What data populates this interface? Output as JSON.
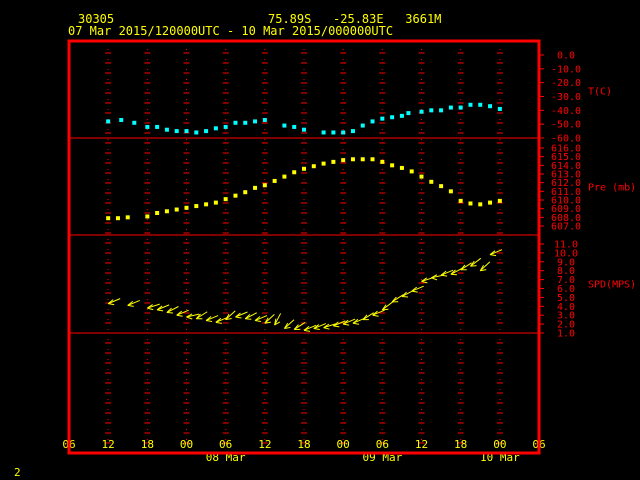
{
  "header": {
    "station_id": "30305",
    "location": "75.89S   -25.83E   3661M",
    "time_range": "07 Mar 2015/120000UTC - 10 Mar 2015/000000UTC"
  },
  "page_number": "2",
  "colors": {
    "frame": "#ff0000",
    "temperature": "#00ffff",
    "pressure": "#ffff00",
    "wind": "#ffff00",
    "text": "#ffff00"
  },
  "chart_data": {
    "type": "scatter",
    "x_axis": {
      "tick_labels": [
        "06",
        "12",
        "18",
        "00",
        "06",
        "12",
        "18",
        "00",
        "06",
        "12",
        "18",
        "00",
        "06"
      ],
      "day_labels": [
        "08 Mar",
        "09 Mar",
        "10 Mar"
      ],
      "xlim_hours": [
        -6,
        66
      ]
    },
    "panels": [
      {
        "name": "T(C)",
        "ylim": [
          -60,
          0
        ],
        "y_ticks": [
          "0.0",
          "-10.0",
          "-20.0",
          "-30.0",
          "-40.0",
          "-50.0",
          "-60.0"
        ],
        "x_hours": [
          0,
          2,
          4,
          6,
          7.5,
          9,
          10.5,
          12,
          13.5,
          15,
          16.5,
          18,
          19.5,
          21,
          22.5,
          24,
          27,
          28.5,
          30,
          33,
          34.5,
          36,
          37.5,
          39,
          40.5,
          42,
          43.5,
          45,
          46,
          48,
          49.5,
          51,
          52.5,
          54,
          55.5,
          57,
          58.5,
          60
        ],
        "values": [
          -48,
          -47,
          -49,
          -52,
          -52,
          -54,
          -55,
          -55,
          -56,
          -55,
          -53,
          -52,
          -49,
          -49,
          -48,
          -47,
          -51,
          -52,
          -54,
          -56,
          -56,
          -56,
          -55,
          -51,
          -48,
          -46,
          -45,
          -44,
          -42,
          -41,
          -40,
          -40,
          -38,
          -38,
          -36,
          -36,
          -37,
          -39
        ]
      },
      {
        "name": "Pre (mb)",
        "ylim": [
          607,
          616
        ],
        "y_ticks": [
          "616.0",
          "615.0",
          "614.0",
          "613.0",
          "612.0",
          "611.0",
          "610.0",
          "609.0",
          "608.0",
          "607.0"
        ],
        "x_hours": [
          0,
          1.5,
          3,
          6,
          7.5,
          9,
          10.5,
          12,
          13.5,
          15,
          16.5,
          18,
          19.5,
          21,
          22.5,
          24,
          25.5,
          27,
          28.5,
          30,
          31.5,
          33,
          34.5,
          36,
          37.5,
          39,
          40.5,
          42,
          43.5,
          45,
          46.5,
          48,
          49.5,
          51,
          52.5,
          54,
          55.5,
          57,
          58.5,
          60
        ],
        "values": [
          607.9,
          607.9,
          608,
          608.1,
          608.5,
          608.7,
          608.9,
          609.1,
          609.3,
          609.5,
          609.7,
          610.1,
          610.5,
          610.9,
          611.4,
          611.7,
          612.2,
          612.7,
          613.2,
          613.6,
          613.9,
          614.2,
          614.4,
          614.6,
          614.7,
          614.7,
          614.7,
          614.4,
          614.0,
          613.7,
          613.3,
          612.7,
          612.1,
          611.6,
          611.0,
          609.9,
          609.6,
          609.5,
          609.7,
          609.9
        ]
      },
      {
        "name": "SPD(MPS)",
        "ylim": [
          1,
          11
        ],
        "y_ticks": [
          "11.0",
          "10.0",
          "9.0",
          "8.0",
          "7.0",
          "6.0",
          "5.0",
          "4.0",
          "3.0",
          "2.0",
          "1.0"
        ],
        "x_hours": [
          0,
          3,
          6,
          7.5,
          9,
          10.5,
          12,
          13.5,
          15,
          16.5,
          18,
          19.5,
          21,
          22.5,
          24,
          25.5,
          27,
          28.5,
          30,
          31.5,
          33,
          34.5,
          36,
          37.5,
          39,
          40.5,
          42,
          43.5,
          45,
          46.5,
          48,
          49.5,
          51,
          52.5,
          54,
          55.5,
          57,
          58.5
        ],
        "values": [
          4.3,
          4.1,
          3.8,
          3.6,
          3.3,
          3.0,
          2.8,
          2.6,
          2.4,
          2.2,
          2.5,
          2.8,
          2.6,
          2.4,
          2.1,
          1.9,
          1.5,
          1.4,
          1.3,
          1.5,
          1.6,
          1.8,
          2.0,
          2.1,
          2.5,
          3.0,
          3.6,
          4.5,
          5.1,
          5.7,
          6.8,
          7.2,
          7.5,
          7.6,
          8.1,
          8.5,
          8.0,
          9.8
        ],
        "direction_deg": [
          60,
          60,
          65,
          60,
          55,
          60,
          70,
          50,
          60,
          60,
          40,
          60,
          55,
          60,
          40,
          20,
          40,
          50,
          60,
          60,
          65,
          60,
          60,
          60,
          50,
          60,
          45,
          50,
          55,
          60,
          65,
          70,
          60,
          55,
          50,
          45,
          40,
          60
        ]
      }
    ],
    "title": "",
    "legend": "none"
  }
}
